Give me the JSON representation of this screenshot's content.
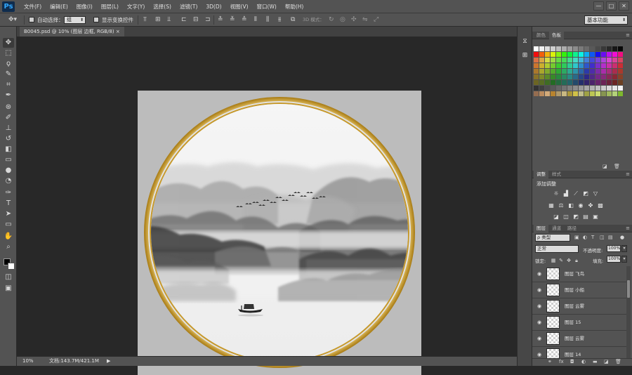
{
  "app": {
    "logo": "Ps"
  },
  "menubar": {
    "items": [
      "文件(F)",
      "编辑(E)",
      "图像(I)",
      "图层(L)",
      "文字(Y)",
      "选择(S)",
      "滤镜(T)",
      "3D(D)",
      "视图(V)",
      "窗口(W)",
      "帮助(H)"
    ],
    "window_controls": [
      "—",
      "□",
      "✕"
    ]
  },
  "options": {
    "auto_select_label": "自动选择：",
    "auto_select_value": "组",
    "show_transform_label": "显示变换控件",
    "mode_3d_label": "3D 模式：",
    "workspace": "基本功能"
  },
  "document": {
    "tab_title": "B0045.psd @ 10% (图层 边框, RGB/8)",
    "zoom": "10%",
    "doc_size": "文档:143.7M/421.1M"
  },
  "panels": {
    "swatches_tabs": [
      "颜色",
      "色板"
    ],
    "adjustments_tabs": [
      "调整",
      "样式"
    ],
    "adjustments_title": "添加调整",
    "layers_tabs": [
      "图层",
      "通道",
      "路径"
    ],
    "layer_filter": "ρ 类型",
    "blend_mode": "正常",
    "opacity_label": "不透明度:",
    "opacity_value": "100%",
    "lock_label": "锁定:",
    "fill_label": "填充:",
    "fill_value": "100%",
    "layers": [
      {
        "name": "图层 飞鸟"
      },
      {
        "name": "图层 小船"
      },
      {
        "name": "图层 云雾"
      },
      {
        "name": "图层 15"
      },
      {
        "name": "图层 云雾"
      },
      {
        "name": "图层 14"
      }
    ]
  },
  "icons": {
    "tools": [
      "move-icon",
      "marquee-icon",
      "lasso-icon",
      "quick-select-icon",
      "crop-icon",
      "eyedropper-icon",
      "healing-brush-icon",
      "brush-icon",
      "clone-stamp-icon",
      "history-brush-icon",
      "eraser-icon",
      "gradient-icon",
      "blur-icon",
      "dodge-icon",
      "pen-icon",
      "type-icon",
      "path-select-icon",
      "rectangle-icon",
      "hand-icon",
      "zoom-icon"
    ],
    "eye": "eye-icon"
  },
  "colors": {
    "frame_gold": "#c9a233",
    "foreground": "#000000",
    "background": "#ffffff",
    "ui_dark": "#282828",
    "ui_panel": "#535353"
  }
}
